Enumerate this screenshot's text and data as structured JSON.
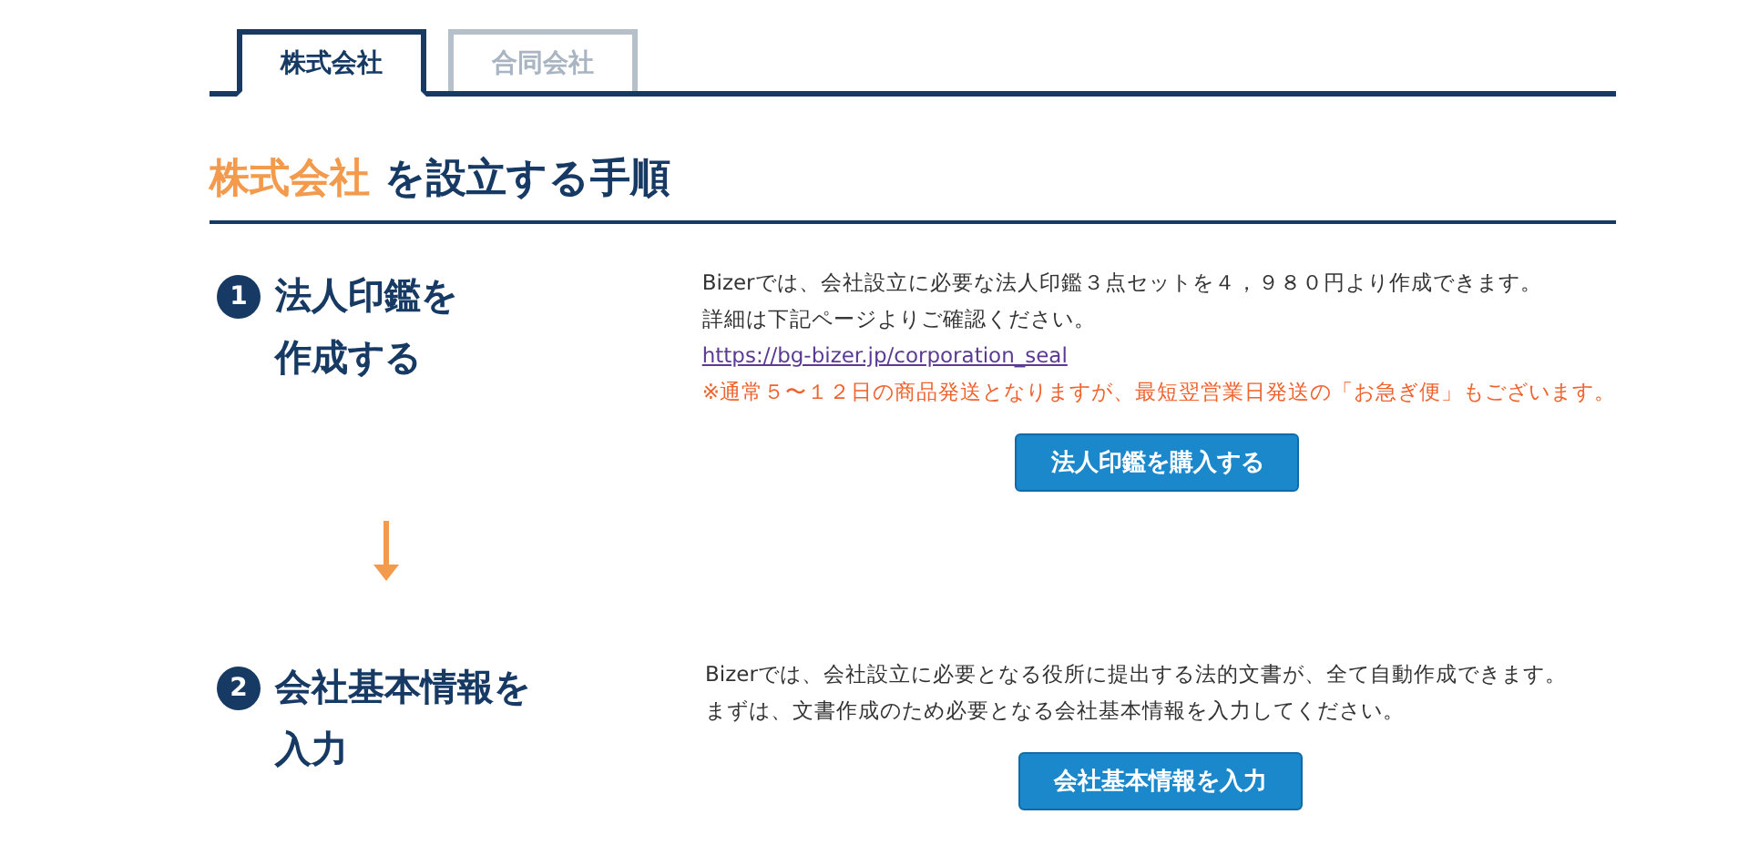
{
  "tabs": [
    {
      "label": "株式会社",
      "selected": true
    },
    {
      "label": "合同会社",
      "selected": false
    }
  ],
  "heading": {
    "highlight": "株式会社",
    "rest": "を設立する手順"
  },
  "steps": [
    {
      "number": "1",
      "title_lines": [
        "法人印鑑を",
        "作成する"
      ],
      "paragraphs": [
        {
          "kind": "text",
          "text": "Bizerでは、会社設立に必要な法人印鑑３点セットを４，９８０円より作成できます。"
        },
        {
          "kind": "text",
          "text": "詳細は下記ページよりご確認ください。"
        },
        {
          "kind": "link",
          "text": "https://bg-bizer.jp/corporation_seal"
        },
        {
          "kind": "note",
          "text": "※通常５〜１２日の商品発送となりますが、最短翌営業日発送の「お急ぎ便」もございます。"
        }
      ],
      "button": "法人印鑑を購入する"
    },
    {
      "number": "2",
      "title_lines": [
        "会社基本情報を",
        "入力"
      ],
      "paragraphs": [
        {
          "kind": "text",
          "text": "Bizerでは、会社設立に必要となる役所に提出する法的文書が、全て自動作成できます。"
        },
        {
          "kind": "text",
          "text": "まずは、文書作成のため必要となる会社基本情報を入力してください。"
        }
      ],
      "button": "会社基本情報を入力"
    }
  ]
}
